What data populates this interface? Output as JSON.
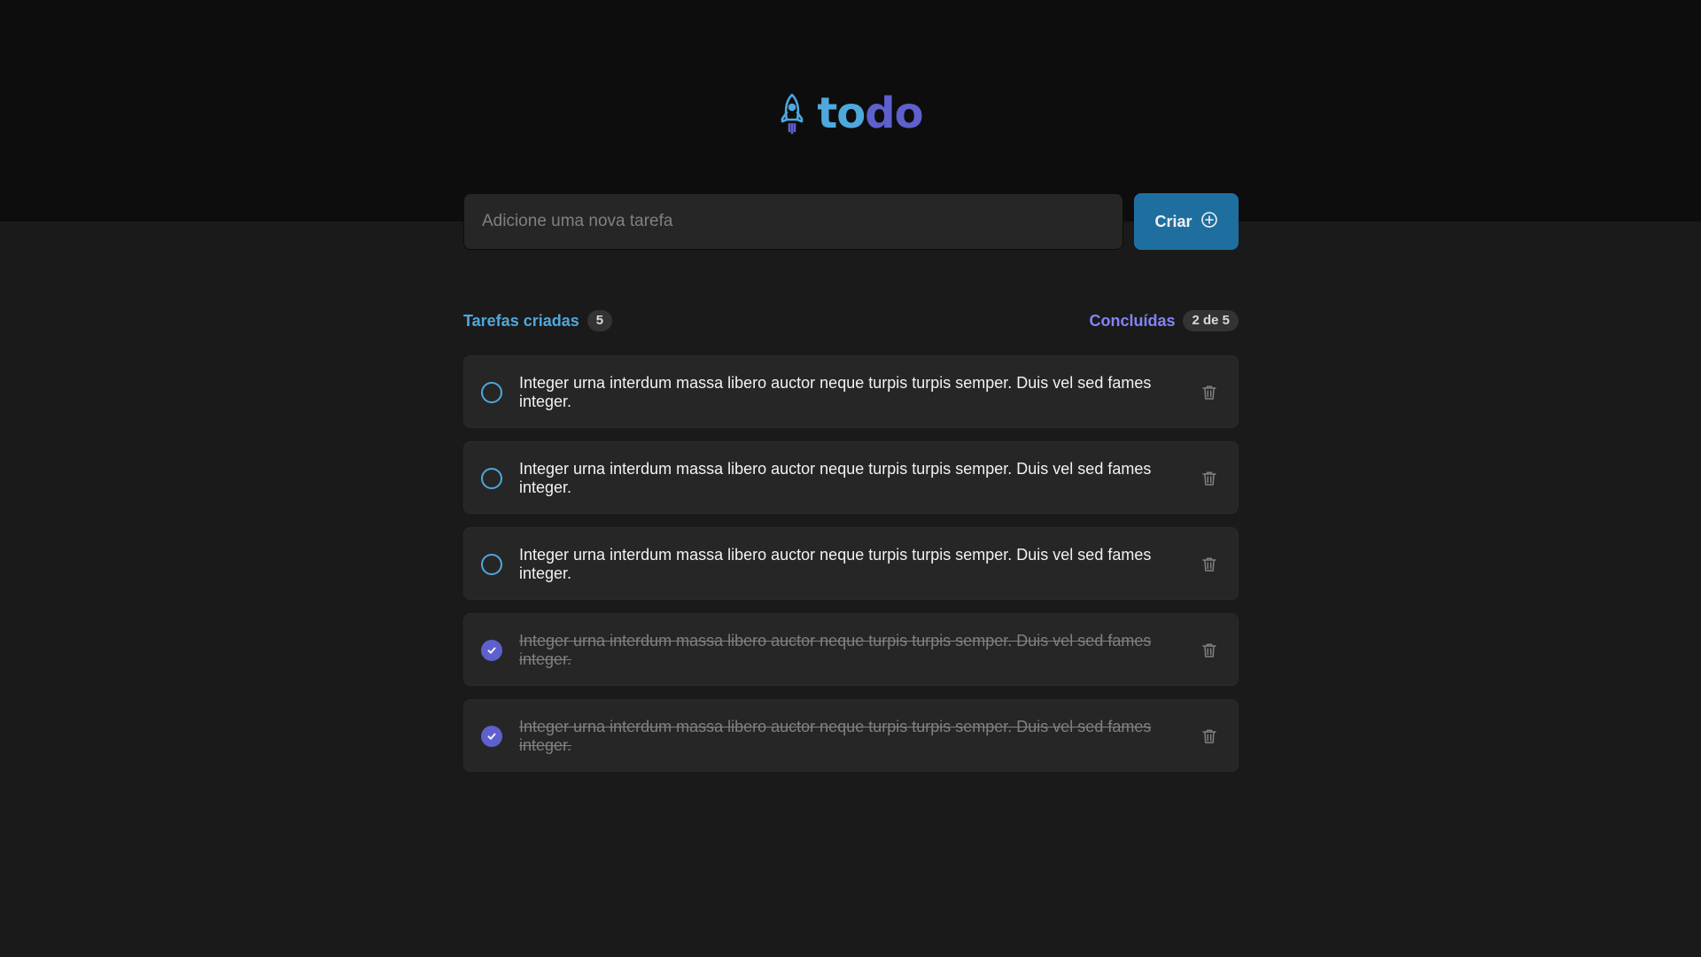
{
  "app": {
    "logo_part1": "to",
    "logo_part2": "do"
  },
  "form": {
    "placeholder": "Adicione uma nova tarefa",
    "value": "",
    "create_label": "Criar"
  },
  "stats": {
    "created_label": "Tarefas criadas",
    "created_count": "5",
    "done_label": "Concluídas",
    "done_count": "2 de 5"
  },
  "tasks": [
    {
      "text": "Integer urna interdum massa libero auctor neque turpis turpis semper. Duis vel sed fames integer.",
      "done": false
    },
    {
      "text": "Integer urna interdum massa libero auctor neque turpis turpis semper. Duis vel sed fames integer.",
      "done": false
    },
    {
      "text": "Integer urna interdum massa libero auctor neque turpis turpis semper. Duis vel sed fames integer.",
      "done": false
    },
    {
      "text": "Integer urna interdum massa libero auctor neque turpis turpis semper. Duis vel sed fames integer.",
      "done": true
    },
    {
      "text": "Integer urna interdum massa libero auctor neque turpis turpis semper. Duis vel sed fames integer.",
      "done": true
    }
  ],
  "colors": {
    "blue": "#4ea8de",
    "blue_dark": "#1e6f9f",
    "purple": "#5e60ce",
    "purple_light": "#8284fa"
  },
  "icons": {
    "logo": "rocket-icon",
    "create": "plus-circle-icon",
    "unchecked": "empty-circle-icon",
    "checked": "check-circle-icon",
    "delete": "trash-icon"
  }
}
